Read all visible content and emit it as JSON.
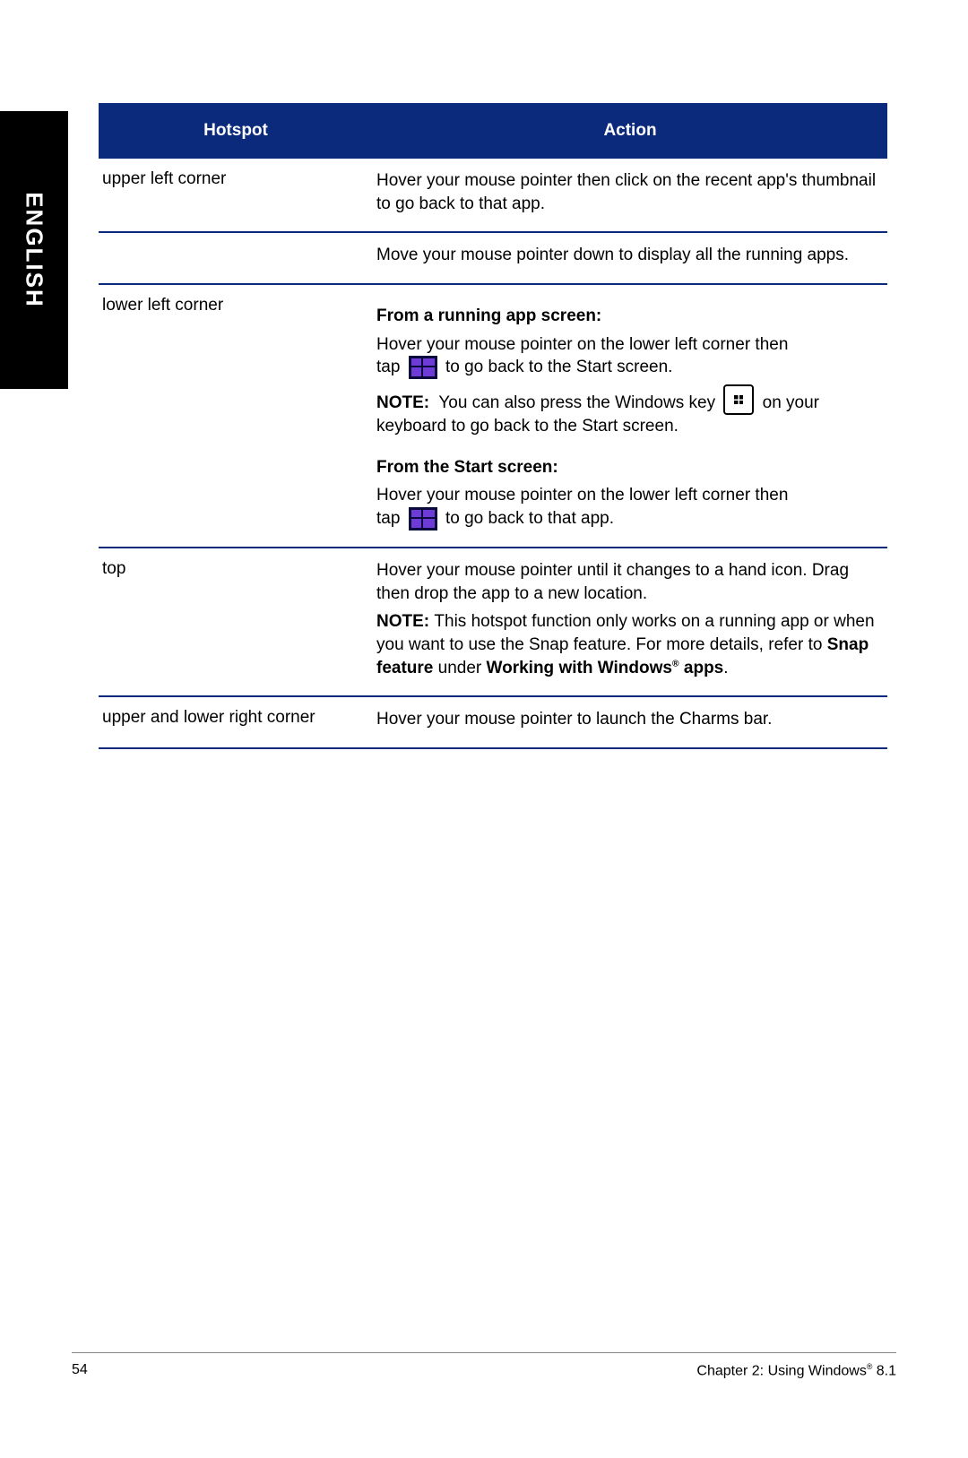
{
  "side_tab": "ENGLISH",
  "table": {
    "headers": {
      "hotspot": "Hotspot",
      "action": "Action"
    },
    "rows": {
      "r1": {
        "hot": "upper left corner",
        "act": "Hover your mouse pointer then click on the recent app's thumbnail to go back to that app."
      },
      "r2": {
        "hot": "",
        "act": "Move your mouse pointer down to display all the running apps."
      },
      "r3": {
        "hot": "lower left corner",
        "h1": "From a running app screen:",
        "p1a": "Hover your mouse pointer on the lower left corner then",
        "p1b": "tap",
        "p1c": "to go back to the Start screen.",
        "note_label": "NOTE:",
        "p2a": "You can also press the Windows key",
        "p2b": "on your keyboard to go back to the Start screen.",
        "h2": "From the Start screen:",
        "p3a": "Hover your mouse pointer on the lower left corner then",
        "p3b": "tap",
        "p3c": "to go back to that app."
      },
      "r4": {
        "hot": "top",
        "p1": "Hover your mouse pointer until it changes to a hand icon. Drag then drop the app to a new location.",
        "note_label": "NOTE:",
        "p2a": "This hotspot function only works on a running app or when you want to use the Snap feature. For more details, refer to ",
        "p2b": "Snap feature",
        "p2c": " under ",
        "p2d": "Working with Windows",
        "p2e": " apps",
        "p2f": "."
      },
      "r5": {
        "hot": "upper and lower right corner",
        "act": "Hover your mouse pointer to launch the Charms bar."
      }
    }
  },
  "footer": {
    "page": "54",
    "chapter_a": "Chapter 2: Using Windows",
    "chapter_b": " 8.1"
  }
}
